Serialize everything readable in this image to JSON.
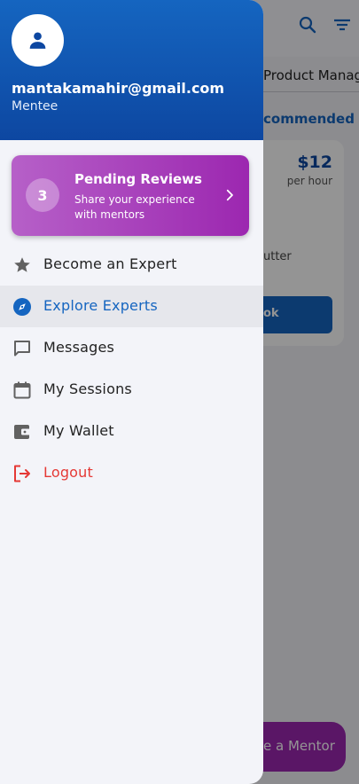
{
  "user": {
    "email": "mantakamahir@gmail.com",
    "role": "Mentee"
  },
  "pending_reviews": {
    "count": "3",
    "title": "Pending Reviews",
    "subtitle": "Share your experience with mentors"
  },
  "menu": {
    "items": [
      {
        "label": "Become an Expert",
        "icon": "star-icon"
      },
      {
        "label": "Explore Experts",
        "icon": "compass-icon",
        "active": true
      },
      {
        "label": "Messages",
        "icon": "chat-icon"
      },
      {
        "label": "My Sessions",
        "icon": "calendar-icon"
      },
      {
        "label": "My Wallet",
        "icon": "wallet-icon"
      },
      {
        "label": "Logout",
        "icon": "logout-icon",
        "danger": true
      }
    ]
  },
  "background": {
    "tab_partial": "Product Manag",
    "section_partial": "commended",
    "price": "$12",
    "price_unit": "per hour",
    "tag_partial": "utter",
    "book_partial": "ok",
    "fab_partial": "e a Mentor"
  },
  "colors": {
    "primary": "#1565c0",
    "accent": "#9c27b0",
    "danger": "#e53935"
  }
}
